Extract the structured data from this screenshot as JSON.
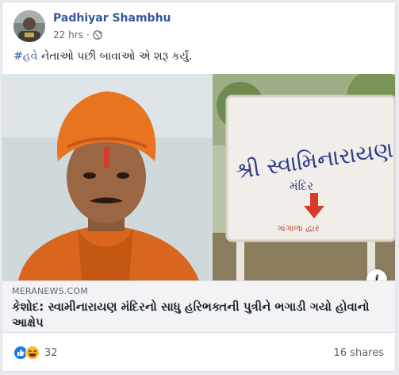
{
  "post": {
    "author": "Padhiyar Shambhu",
    "time": "22 hrs",
    "separator": "·",
    "privacy_icon": "globe-icon",
    "text_hashtag": "#હવે",
    "text_body": " નેતાઓ પછી બાવાઓ એ શરૂ કર્યું."
  },
  "media": {
    "sign_top": "શ્રી સ્વામિનારાયણ",
    "sign_middle": "મંદિર",
    "sign_bottom": "ગાંગાળા દ્વાર",
    "info_label": "i"
  },
  "link": {
    "domain": "MERANEWS.COM",
    "title": "કેશોદ: સ્વામીનારાયણ મંદિરનો સાધુ હરિભક્તની પુત્રીને ભગાડી ગયો હોવાનો આક્ષેપ"
  },
  "footer": {
    "reaction_count": "32",
    "shares": "16 shares",
    "reaction_icons": [
      "like-icon",
      "haha-icon"
    ]
  },
  "colors": {
    "author_link": "#365899",
    "like_blue": "#1877f2",
    "haha_yellow": "#f7b928"
  }
}
